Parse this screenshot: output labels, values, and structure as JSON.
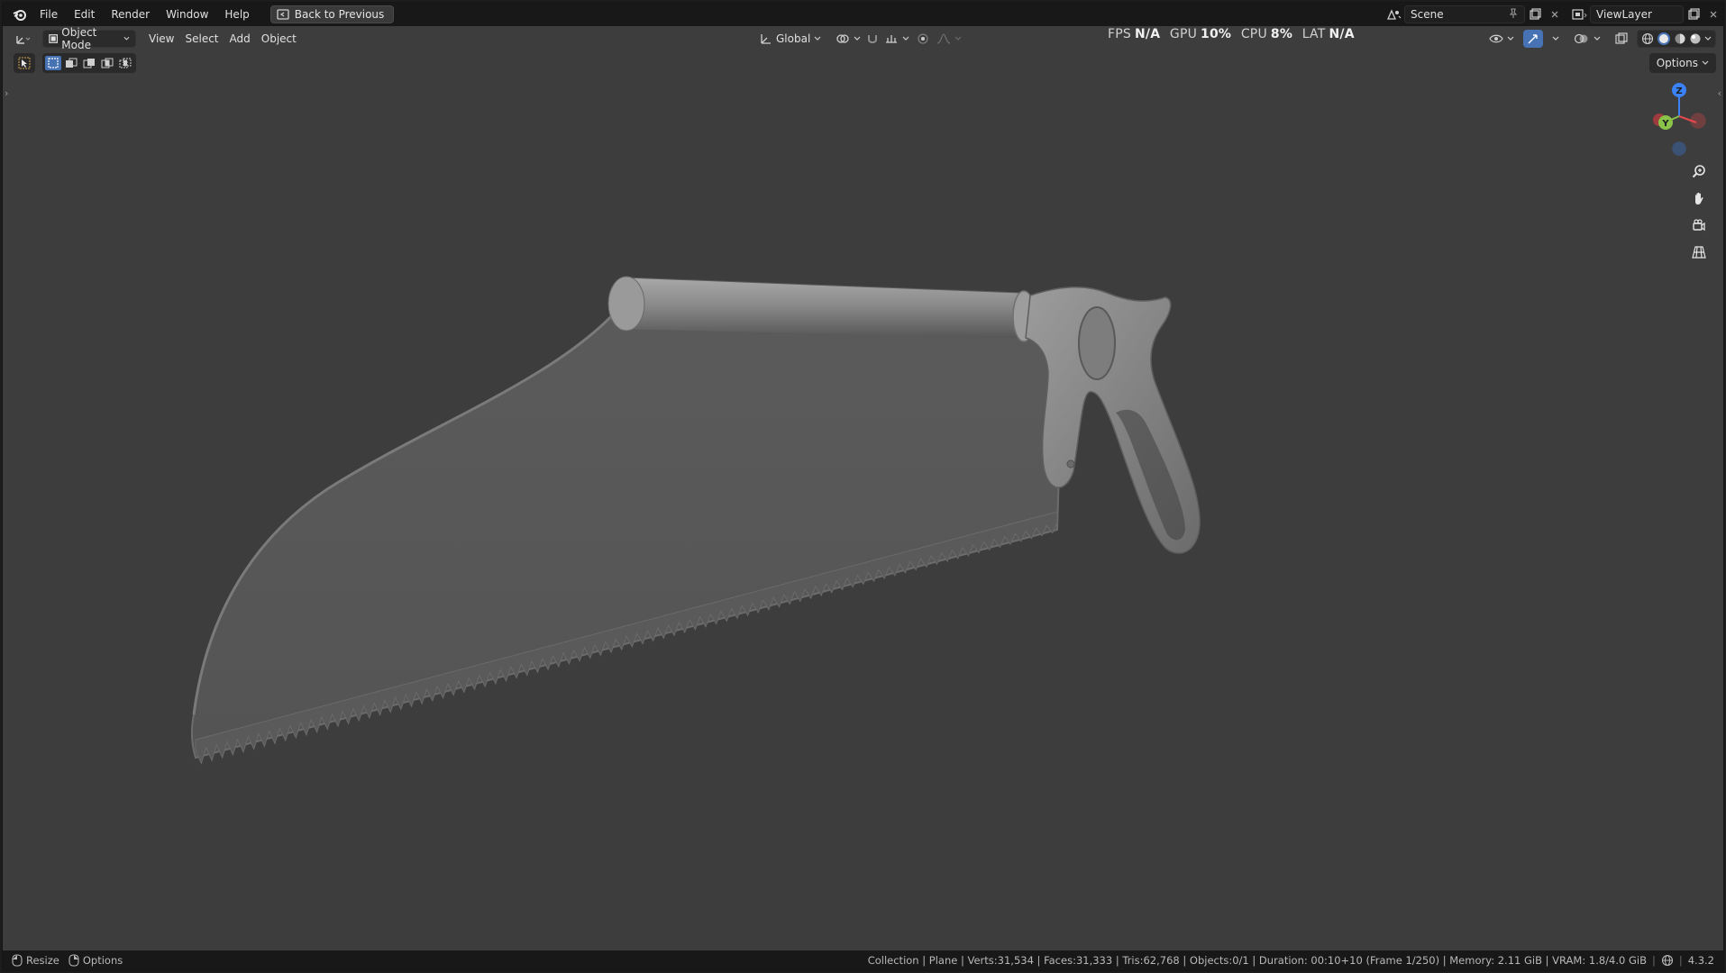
{
  "menubar": {
    "items": [
      "File",
      "Edit",
      "Render",
      "Window",
      "Help"
    ],
    "back_button": "Back to Previous"
  },
  "top_right": {
    "scene_label": "Scene",
    "viewlayer_label": "ViewLayer"
  },
  "viewport_header": {
    "mode_label": "Object Mode",
    "menus": [
      "View",
      "Select",
      "Add",
      "Object"
    ],
    "transform_orientation": "Global"
  },
  "stats": {
    "fps_label": "FPS",
    "fps_value": "N/A",
    "gpu_label": "GPU",
    "gpu_value": "10%",
    "cpu_label": "CPU",
    "cpu_value": "8%",
    "lat_label": "LAT",
    "lat_value": "N/A"
  },
  "options_label": "Options",
  "gizmo": {
    "z": "Z",
    "y": "Y"
  },
  "statusbar": {
    "resize_label": "Resize",
    "options_label": "Options",
    "info": "Collection | Plane | Verts:31,534 | Faces:31,333 | Tris:62,768 | Objects:0/1 | Duration: 00:10+10 (Frame 1/250) | Memory: 2.11 GiB | VRAM: 1.8/4.0 GiB",
    "version": "4.3.2"
  },
  "colors": {
    "viewport_bg": "#3d3d3d",
    "header_bg": "#181818",
    "accent_blue": "#4772b3",
    "axis_x": "#e5484d",
    "axis_y": "#8bc34a",
    "axis_z": "#3b82f6"
  }
}
